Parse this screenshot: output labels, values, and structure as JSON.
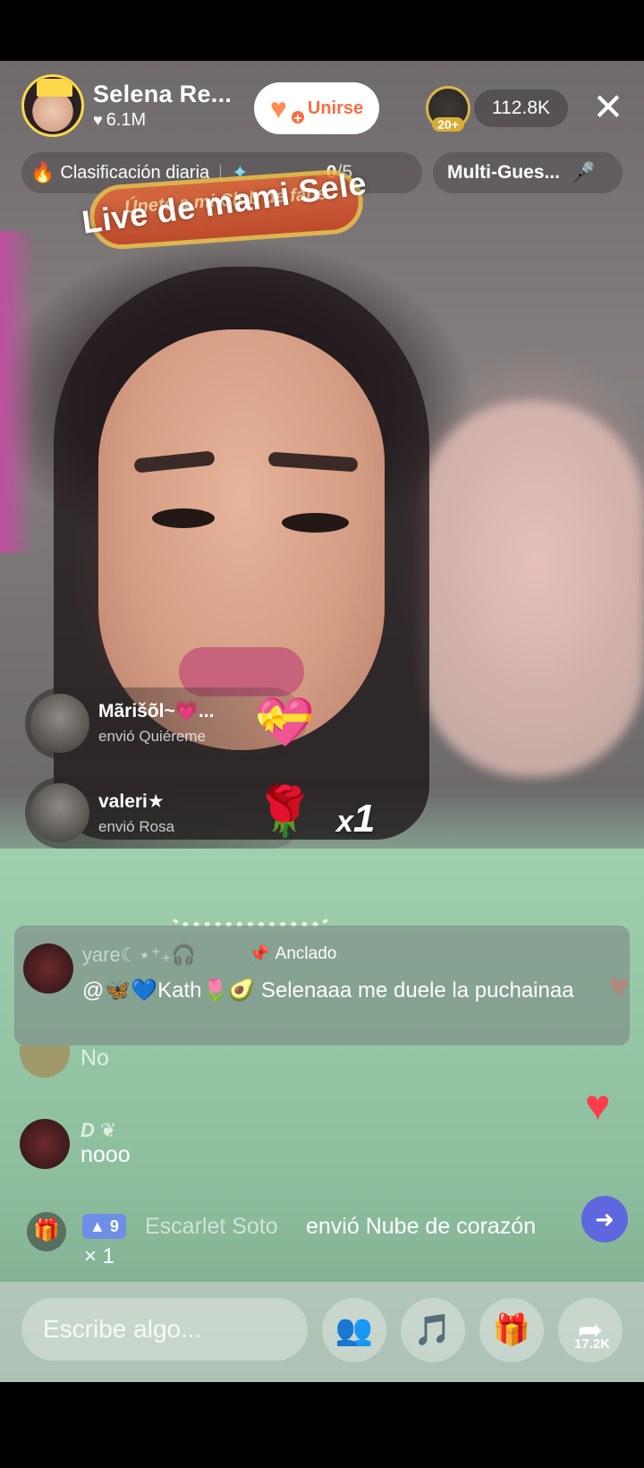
{
  "header": {
    "host_name": "Selena Re...",
    "host_likes": "6.1M",
    "join_label": "Unirse",
    "rank_badge": "20+",
    "viewer_count": "112.8K"
  },
  "ranking": {
    "label": "Clasificación diaria",
    "score": "0",
    "score_total": "/5"
  },
  "multi_guest": {
    "label": "Multi-Gues..."
  },
  "fanclub_banner": "Únete a mi Club de fans",
  "stream_title": "Live de mami Sele",
  "gift_notifications": [
    {
      "user": "Mãrišõl~💗...",
      "action": "envió Quiéreme",
      "gift_icon": "heart-face-gift"
    },
    {
      "user": "valeri★",
      "action": "envió Rosa",
      "gift_icon": "rose-gift"
    }
  ],
  "combo": {
    "prefix": "x",
    "count": "1"
  },
  "pinned_comment": {
    "user": "yare☾⋆⁺₊🎧",
    "tag": "Anclado",
    "message": "@🦋💙Kath🌷🥑  Selenaaa me duele la puchainaa"
  },
  "comments": [
    {
      "user": "",
      "message": "No"
    },
    {
      "user": "D ❦",
      "message": "nooo"
    }
  ],
  "gift_ticker": {
    "level": "9",
    "user": "Escarlet Soto",
    "action": "envió Nube de corazón",
    "count": "× 1"
  },
  "bottom_bar": {
    "input_placeholder": "Escribe algo...",
    "share_count": "17.2K"
  },
  "colors": {
    "accent_orange": "#f36f43",
    "heart_red": "#ff3b4e",
    "level_badge": "#6f8fe6"
  }
}
